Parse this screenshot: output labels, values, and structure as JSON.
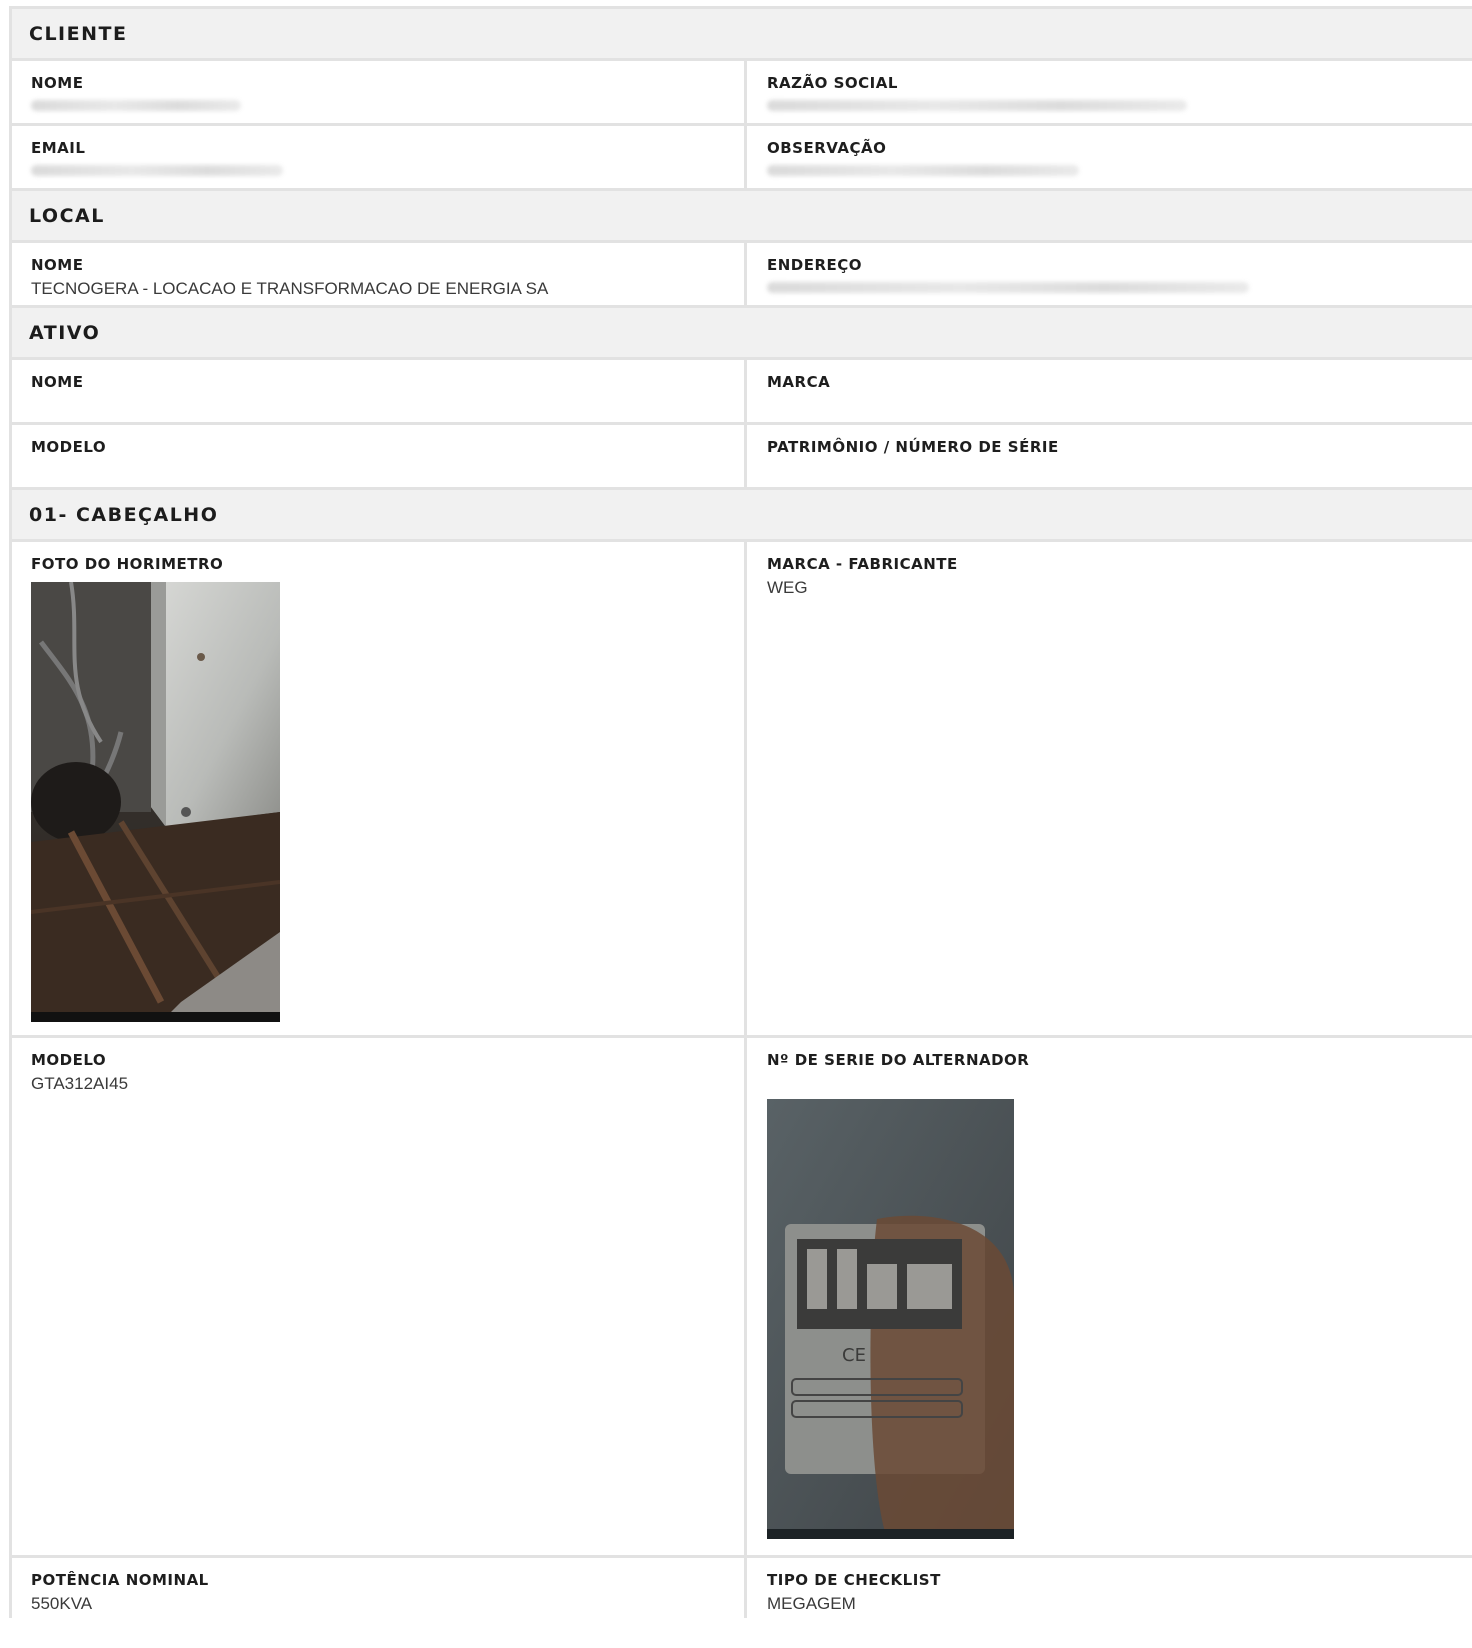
{
  "cliente": {
    "title": "CLIENTE",
    "nome_label": "NOME",
    "razao_label": "RAZÃO SOCIAL",
    "email_label": "EMAIL",
    "obs_label": "OBSERVAÇÃO"
  },
  "local": {
    "title": "LOCAL",
    "nome_label": "NOME",
    "nome_value": "TECNOGERA - LOCACAO E TRANSFORMACAO DE ENERGIA SA",
    "endereco_label": "ENDEREÇO"
  },
  "ativo": {
    "title": "ATIVO",
    "nome_label": "NOME",
    "marca_label": "MARCA",
    "modelo_label": "MODELO",
    "patrimonio_label": "PATRIMÔNIO / NÚMERO DE SÉRIE"
  },
  "cabecalho": {
    "title": "01- CABEÇALHO",
    "foto_label": "FOTO DO HORIMETRO",
    "marca_label": "MARCA - FABRICANTE",
    "marca_value": "WEG",
    "modelo_label": "MODELO",
    "modelo_value": "GTA312AI45",
    "serie_label": "Nº DE SERIE DO ALTERNADOR",
    "potencia_label": "POTÊNCIA NOMINAL",
    "potencia_value": "550KVA",
    "tipo_label": "TIPO DE CHECKLIST",
    "tipo_value": "MEGAGEM"
  },
  "colors": {
    "section_bg": "#f1f1f1",
    "border": "#e2e2e2",
    "label": "#1e1e1e",
    "value": "#3a3a3a"
  }
}
